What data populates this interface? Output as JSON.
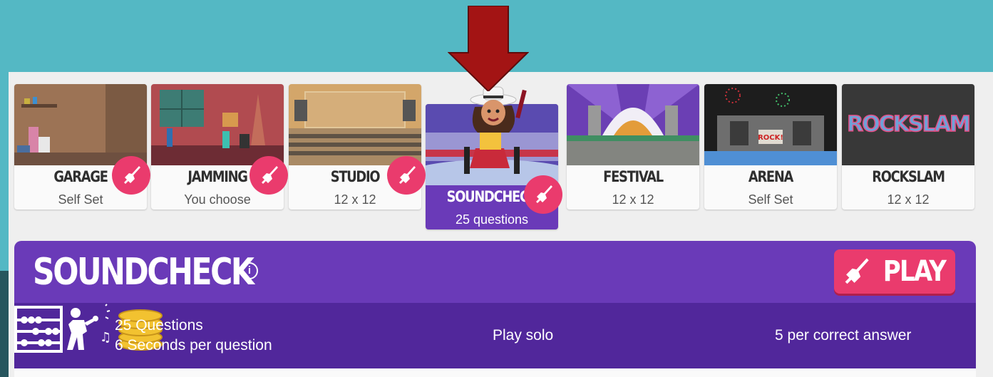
{
  "game_modes": [
    {
      "name": "GARAGE",
      "subtitle": "Self Set"
    },
    {
      "name": "JAMMING",
      "subtitle": "You choose"
    },
    {
      "name": "STUDIO",
      "subtitle": "12 x 12"
    },
    {
      "name": "SOUNDCHECK",
      "subtitle": "25 questions",
      "selected": true
    },
    {
      "name": "FESTIVAL",
      "subtitle": "12 x 12"
    },
    {
      "name": "ARENA",
      "subtitle": "Self Set"
    },
    {
      "name": "ROCKSLAM",
      "subtitle": "12 x 12"
    }
  ],
  "rockslam_logo_text": "ROCKSLAM",
  "arena_sign_text": "ROCK!",
  "selected_mode": {
    "title": "SOUNDCHECK",
    "info_icon": "info-icon",
    "play_label": "PLAY",
    "stats": {
      "questions": "25 Questions",
      "time": "6 Seconds per question",
      "players": "Play solo",
      "reward": "5 per correct answer"
    }
  },
  "colors": {
    "accent_pink": "#ea3b6d",
    "purple": "#6a3ab8",
    "dark_purple": "#51279b",
    "background": "#54b8c4",
    "annotation_arrow": "#a31414"
  }
}
